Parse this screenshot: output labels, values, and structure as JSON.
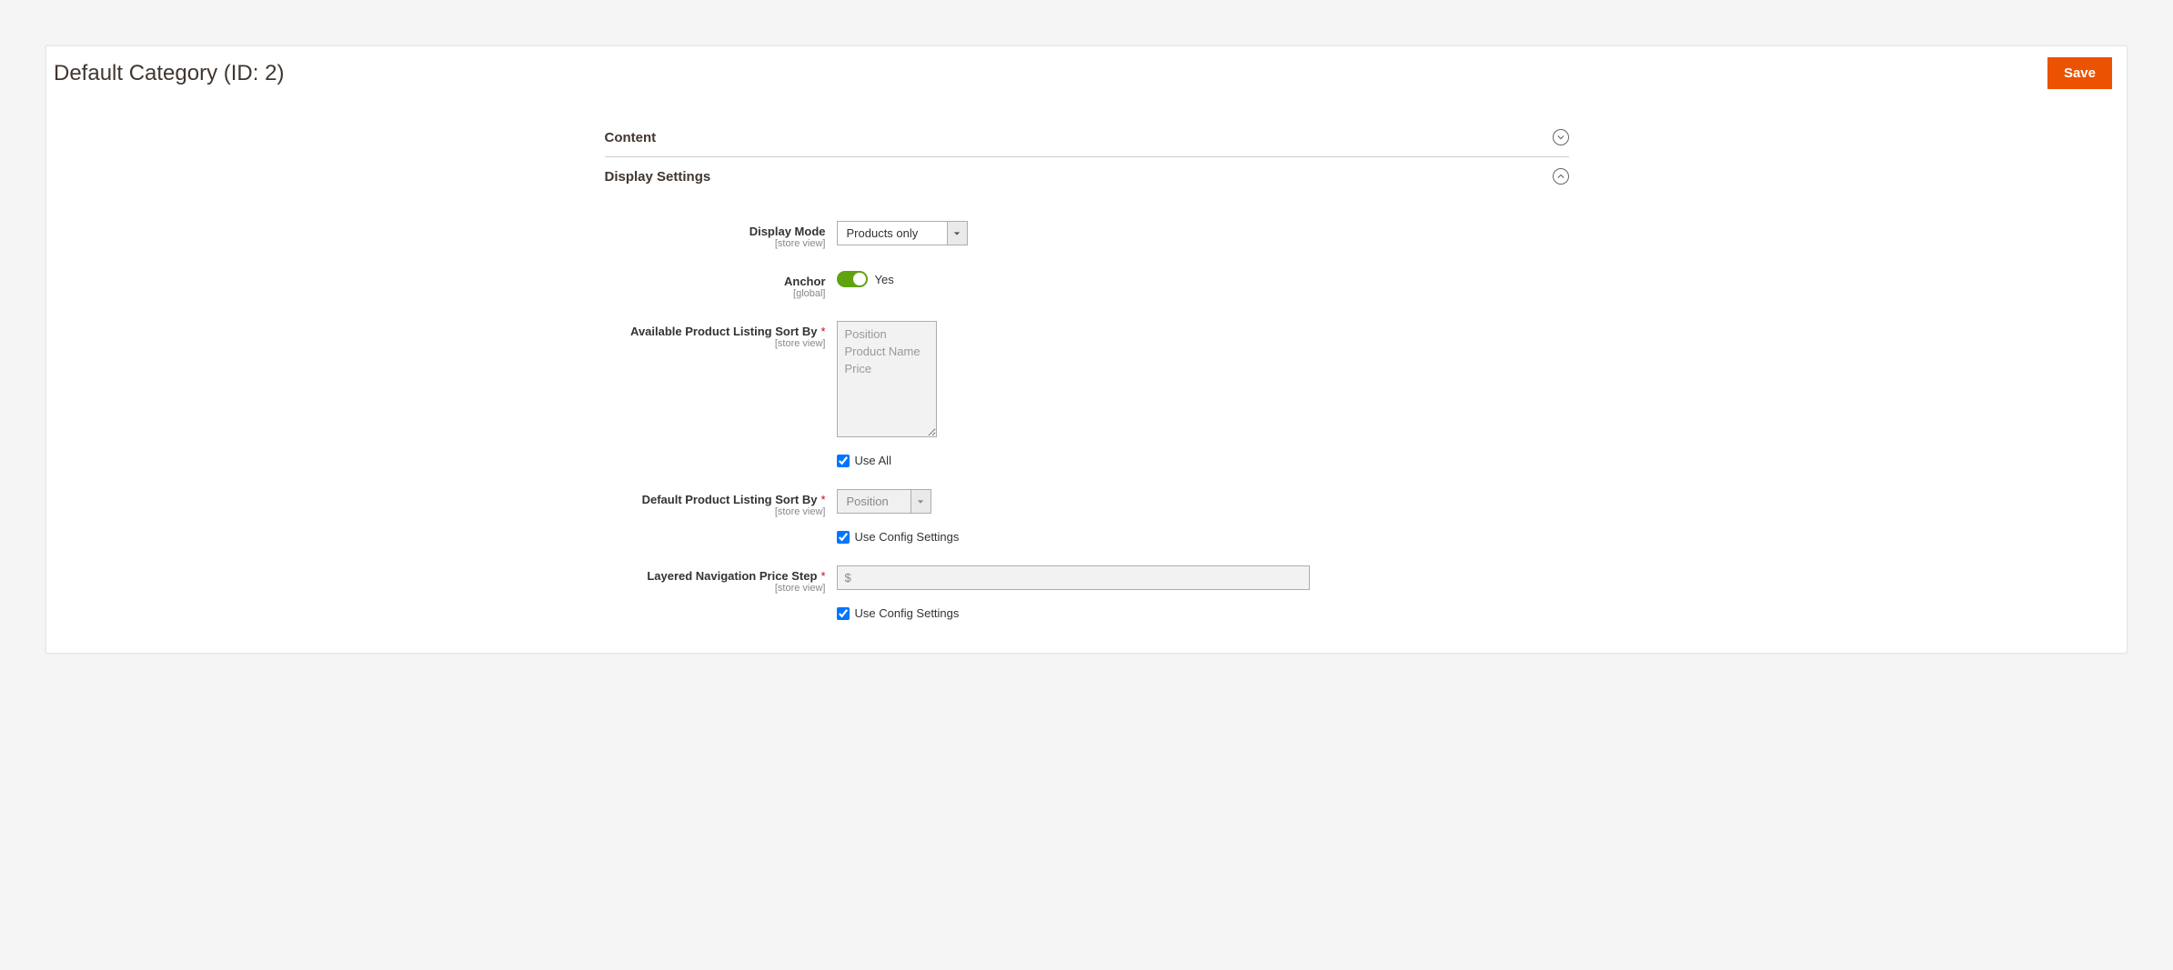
{
  "header": {
    "title": "Default Category (ID: 2)",
    "save_label": "Save"
  },
  "sections": {
    "content": {
      "title": "Content"
    },
    "display": {
      "title": "Display Settings"
    }
  },
  "labels": {
    "display_mode": "Display Mode",
    "anchor": "Anchor",
    "available_sort": "Available Product Listing Sort By",
    "default_sort": "Default Product Listing Sort By",
    "price_step": "Layered Navigation Price Step",
    "scope_store": "[store view]",
    "scope_global": "[global]",
    "use_all": "Use All",
    "use_config": "Use Config Settings",
    "yes": "Yes"
  },
  "values": {
    "display_mode": "Products only",
    "anchor_on": true,
    "sort_options": [
      "Position",
      "Product Name",
      "Price"
    ],
    "default_sort": "Position",
    "price_step_prefix": "$",
    "use_all_checked": true,
    "use_config_default_sort": true,
    "use_config_price_step": true
  }
}
